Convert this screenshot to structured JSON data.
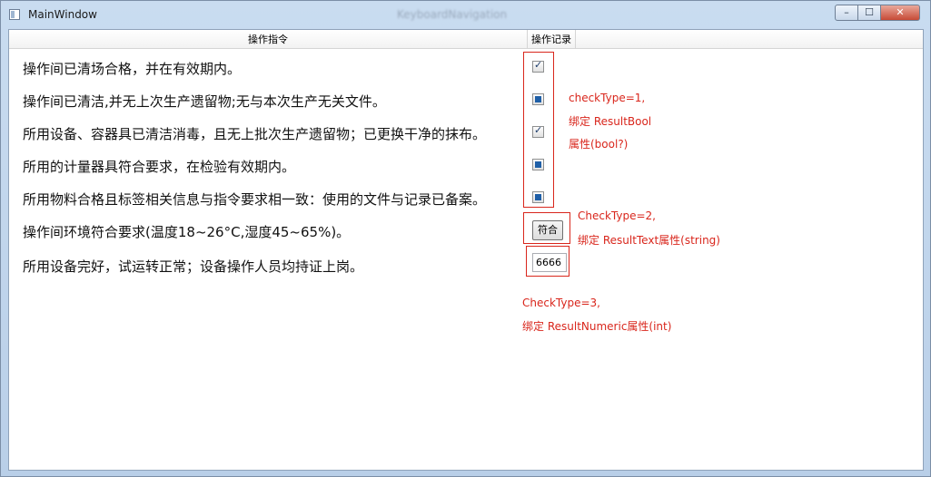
{
  "window": {
    "title": "MainWindow",
    "background_title": "KeyboardNavigation",
    "minimize_glyph": "–",
    "maximize_glyph": "☐",
    "close_glyph": "✕"
  },
  "table": {
    "headers": [
      "操作指令",
      "操作记录"
    ]
  },
  "rows": [
    {
      "instruction": "操作间已清场合格，并在有效期内。",
      "control": "checkbox",
      "state": "checked"
    },
    {
      "instruction": "操作间已清洁,并无上次生产遗留物;无与本次生产无关文件。",
      "control": "checkbox",
      "state": "indeterminate"
    },
    {
      "instruction": "所用设备、容器具已清洁消毒，且无上批次生产遗留物；已更换干净的抹布。",
      "control": "checkbox",
      "state": "checked"
    },
    {
      "instruction": "所用的计量器具符合要求，在检验有效期内。",
      "control": "checkbox",
      "state": "indeterminate"
    },
    {
      "instruction": "所用物料合格且标签相关信息与指令要求相一致：使用的文件与记录已备案。",
      "control": "checkbox",
      "state": "indeterminate"
    },
    {
      "instruction": "操作间环境符合要求(温度18~26°C,湿度45~65%)。",
      "control": "button",
      "value": "符合"
    },
    {
      "instruction": "所用设备完好，试运转正常；设备操作人员均持证上岗。",
      "control": "numeric",
      "value": "6666"
    }
  ],
  "annotations": {
    "bool": [
      "checkType=1,",
      "绑定 ResultBool",
      "属性(bool?)"
    ],
    "text": [
      "CheckType=2,",
      "绑定 ResultText属性(string)"
    ],
    "numeric": [
      "CheckType=3,",
      "绑定 ResultNumeric属性(int)"
    ]
  },
  "colors": {
    "annotation": "#d9261c",
    "checkbox_fill": "#1f5fa7"
  }
}
